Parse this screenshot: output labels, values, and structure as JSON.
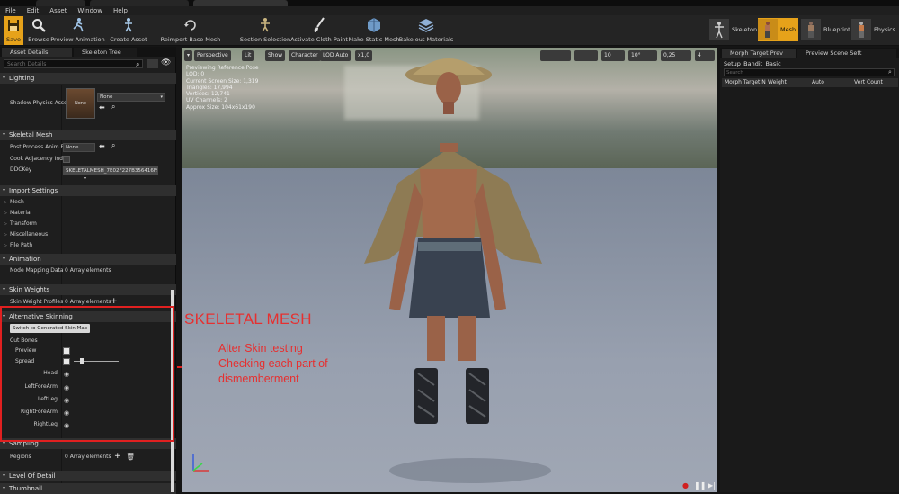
{
  "menu": [
    "File",
    "Edit",
    "Asset",
    "Window",
    "Help"
  ],
  "toolbar": {
    "save": "Save",
    "browse": "Browse",
    "preview_animation": "Preview Animation",
    "create_asset": "Create Asset",
    "reimport": "Reimport Base Mesh",
    "section_selection": "Section Selection",
    "activate_cloth_paint": "Activate Cloth Paint",
    "make_static_mesh": "Make Static Mesh",
    "bake_out_materials": "Bake out Materials",
    "modes": [
      "Skeleton",
      "Mesh",
      "Blueprint",
      "Physics"
    ]
  },
  "left_panel": {
    "tabs": [
      "Asset Details",
      "Skeleton Tree"
    ],
    "search_placeholder": "Search Details",
    "lighting": {
      "title": "Lighting",
      "shadow_physics_label": "Shadow Physics Asse",
      "thumb_label": "None",
      "dropdown": "None"
    },
    "skeletal_mesh": {
      "title": "Skeletal Mesh",
      "post_process_label": "Post Process Anim B",
      "post_process_value": "None",
      "cook_label": "Cook Adjacency Index",
      "ddc_label": "DDCKey",
      "ddc_value": "SKELETALMESH_7E02F227B356416F95"
    },
    "import_settings": {
      "title": "Import Settings",
      "items": [
        "Mesh",
        "Material",
        "Transform",
        "Miscellaneous",
        "File Path"
      ]
    },
    "animation": {
      "title": "Animation",
      "node_mapping_label": "Node Mapping Data",
      "node_mapping_value": "0 Array elements"
    },
    "skin_weights": {
      "title": "Skin Weights",
      "profiles_label": "Skin Weight Profiles",
      "profiles_value": "0 Array elements"
    },
    "alternative_skinning": {
      "title": "Alternative Skinning",
      "switch_button": "Switch to Generated Skin Map",
      "cut_bones": "Cut Bones",
      "preview": "Preview",
      "spread": "Spread",
      "bones": [
        "Head",
        "LeftForeArm",
        "LeftLeg",
        "RightForeArm",
        "RightLeg"
      ]
    },
    "sampling": {
      "title": "Sampling",
      "regions_label": "Regions",
      "regions_value": "0 Array elements"
    },
    "lod_title": "Level Of Detail",
    "thumbnail_title": "Thumbnail"
  },
  "viewport": {
    "buttons": [
      "Perspective",
      "Lit",
      "Show",
      "Character",
      "LOD Auto",
      "x1,0"
    ],
    "right_controls": [
      "10",
      "10°",
      "0,25",
      "4"
    ],
    "info": [
      "Previewing Reference Pose",
      "LOD: 0",
      "Current Screen Size: 1,319",
      "Triangles: 17,994",
      "Vertices: 12,741",
      "UV Channels: 2",
      "Approx Size: 104x61x190"
    ]
  },
  "right_panel": {
    "tabs": [
      "Morph Target Prev",
      "Preview Scene Sett"
    ],
    "asset_name": "Setup_Bandit_Basic",
    "search_placeholder": "Search",
    "columns": [
      "Morph Target N",
      "Weight",
      "Auto",
      "Vert Count"
    ]
  },
  "annotations": {
    "title": "SKELETAL MESH",
    "body_line1": "Alter Skin testing",
    "body_line2": "Checking each part of",
    "body_line3": "dismemberment",
    "color": "#e63030"
  }
}
